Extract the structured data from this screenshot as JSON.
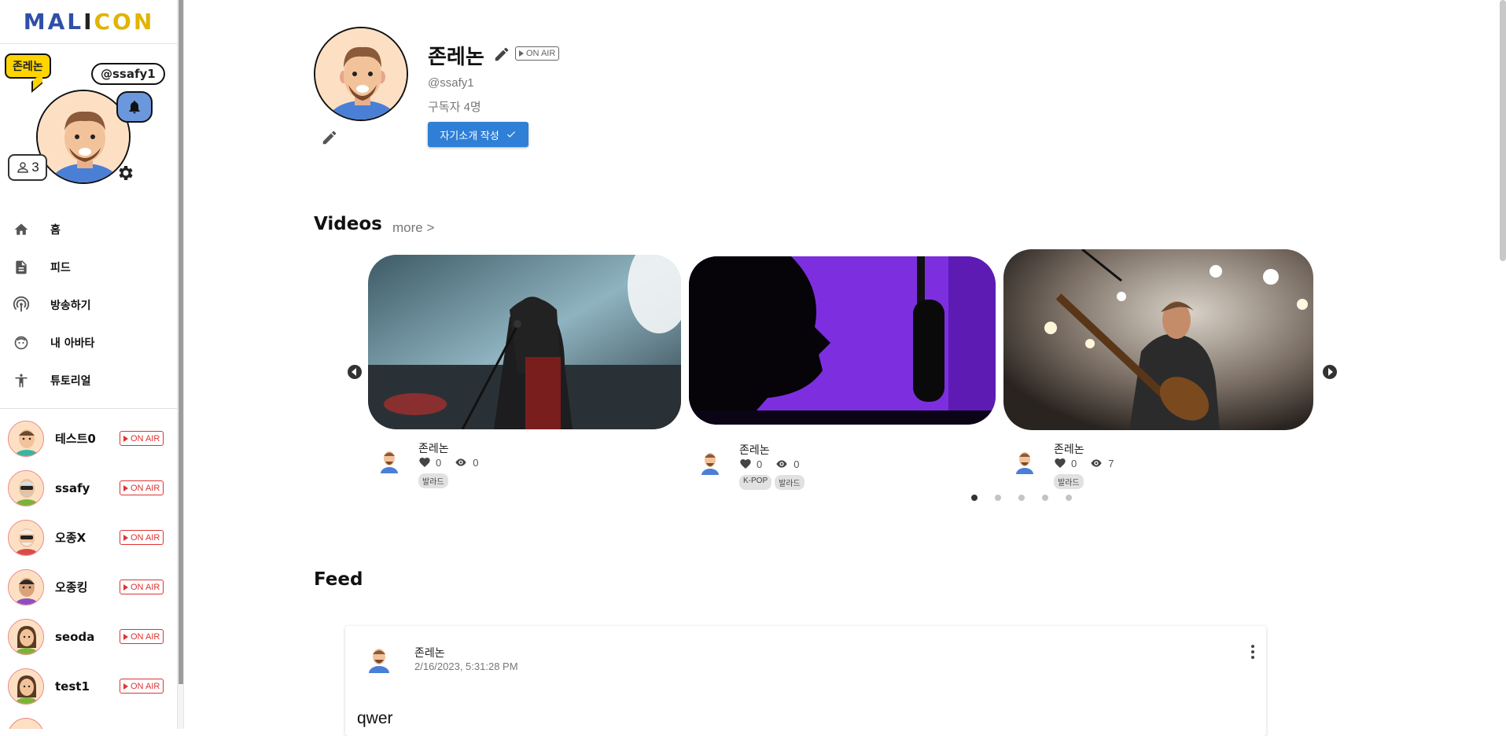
{
  "brand": {
    "logo_text": "MALICON"
  },
  "profile": {
    "display_name": "존레논",
    "handle": "@ssafy1",
    "subscriber_count": "3"
  },
  "nav": [
    {
      "label": "홈",
      "icon": "home-icon"
    },
    {
      "label": "피드",
      "icon": "feed-icon"
    },
    {
      "label": "방송하기",
      "icon": "broadcast-icon"
    },
    {
      "label": "내 아바타",
      "icon": "avatar-face-icon"
    },
    {
      "label": "튜토리얼",
      "icon": "accessibility-icon"
    }
  ],
  "friends": [
    {
      "name": "테스트0",
      "badge": "ON AIR"
    },
    {
      "name": "ssafy",
      "badge": "ON AIR"
    },
    {
      "name": "오종X",
      "badge": "ON AIR"
    },
    {
      "name": "오종킹",
      "badge": "ON AIR"
    },
    {
      "name": "seoda",
      "badge": "ON AIR"
    },
    {
      "name": "test1",
      "badge": "ON AIR"
    }
  ],
  "channel": {
    "name": "존레논",
    "badge": "ON AIR",
    "handle": "@ssafy1",
    "subscribers": "구독자 4명",
    "intro_button": "자기소개 작성"
  },
  "videos_section": {
    "title": "Videos",
    "more_label": "more >",
    "cards": [
      {
        "author": "존레논",
        "likes": "0",
        "views": "0",
        "tags": [
          "발라드"
        ],
        "accent": "#4a9a3a"
      },
      {
        "author": "존레논",
        "likes": "0",
        "views": "0",
        "tags": [
          "K-POP",
          "발라드"
        ],
        "accent": "#e4a91c"
      },
      {
        "author": "존레논",
        "likes": "0",
        "views": "7",
        "tags": [
          "발라드"
        ],
        "accent": "#c4365d"
      }
    ],
    "page_count": 5,
    "active_page": 0
  },
  "feed_section": {
    "title": "Feed",
    "post": {
      "author": "존레논",
      "date": "2/16/2023, 5:31:28 PM",
      "text": "qwer"
    }
  },
  "colors": {
    "on_air_red": "#d33333",
    "primary_blue": "#2f7fd6",
    "logo_yellow": "#ffd400"
  }
}
